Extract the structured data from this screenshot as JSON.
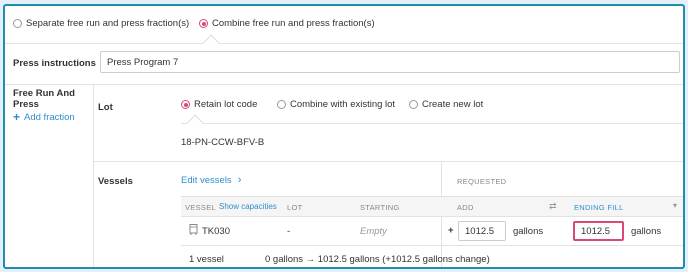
{
  "mode_options": {
    "separate": "Separate free run and press fraction(s)",
    "combine": "Combine free run and press fraction(s)"
  },
  "press_instructions": {
    "label": "Press instructions",
    "value": "Press Program 7"
  },
  "sidebar": {
    "title": "Free Run And Press",
    "add_fraction": "Add fraction"
  },
  "lot": {
    "label": "Lot",
    "options": {
      "retain": "Retain lot code",
      "combine": "Combine with existing lot",
      "create": "Create new lot"
    },
    "code": "18-PN-CCW-BFV-B"
  },
  "vessels": {
    "label": "Vessels",
    "edit_link": "Edit vessels",
    "requested_header": "REQUESTED",
    "columns": {
      "vessel": "VESSEL",
      "show_capacities": "Show capacities",
      "lot": "LOT",
      "starting": "STARTING",
      "add": "ADD",
      "ending_fill": "ENDING FILL"
    },
    "rows": [
      {
        "vessel": "TK030",
        "lot": "-",
        "starting": "Empty",
        "plus": "+",
        "add_value": "1012.5",
        "add_unit": "gallons",
        "ending_value": "1012.5",
        "ending_unit": "gallons"
      }
    ],
    "summary": {
      "count": "1 vessel",
      "change": "0 gallons → 1012.5 gallons (+1012.5 gallons change)"
    }
  },
  "colors": {
    "accent": "#d94878",
    "link": "#2f8ecf",
    "frame": "#1f8ea8",
    "highlight": "#d94878"
  }
}
